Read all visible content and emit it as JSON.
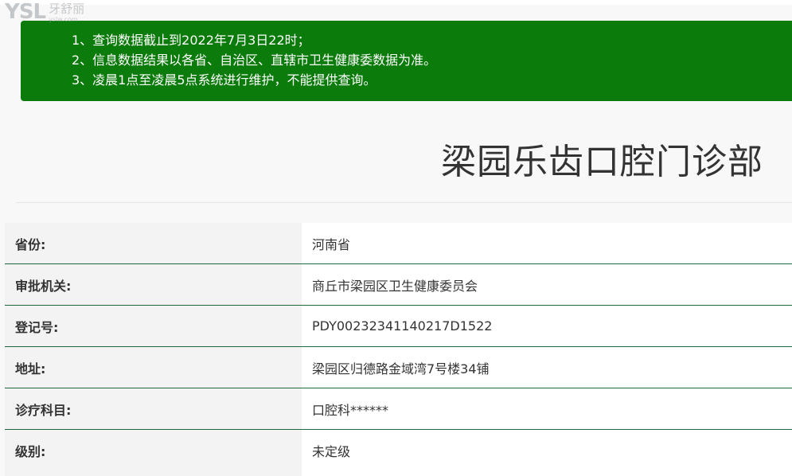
{
  "watermark": {
    "mark": "YSL",
    "name": "牙舒丽",
    "url": "yslw.com"
  },
  "notice": {
    "lines": [
      "1、查询数据截止到2022年7月3日22时；",
      "2、信息数据结果以各省、自治区、直辖市卫生健康委数据为准。",
      "3、凌晨1点至凌晨5点系统进行维护，不能提供查询。"
    ]
  },
  "clinic": {
    "title": "梁园乐齿口腔门诊部"
  },
  "info": [
    {
      "label": "省份:",
      "value": "河南省"
    },
    {
      "label": "审批机关:",
      "value": "商丘市梁园区卫生健康委员会"
    },
    {
      "label": "登记号:",
      "value": "PDY00232341140217D1522"
    },
    {
      "label": "地址:",
      "value": "梁园区归德路金域湾7号楼34铺"
    },
    {
      "label": "诊疗科目:",
      "value": "口腔科******"
    },
    {
      "label": "级别:",
      "value": "未定级"
    }
  ],
  "colors": {
    "notice_bg": "#0b7b0b",
    "row_border": "#1e6a3a"
  }
}
